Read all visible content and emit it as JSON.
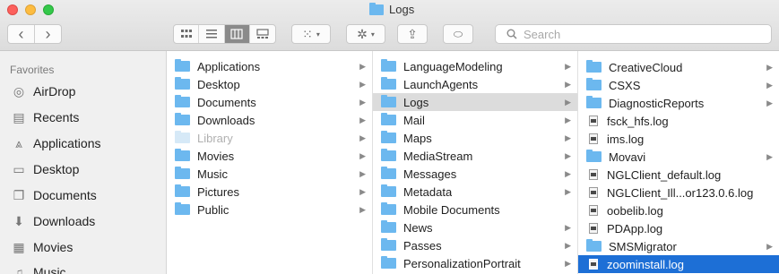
{
  "window": {
    "title": "Logs"
  },
  "toolbar": {
    "back_glyph": "‹",
    "forward_glyph": "›",
    "view_icons": [
      "grid-view-icon",
      "list-view-icon",
      "column-view-icon",
      "gallery-view-icon"
    ],
    "group_glyph": "⁙",
    "action_glyph": "✲",
    "share_glyph": "⇪",
    "tag_glyph": "⬭",
    "search_placeholder": "Search"
  },
  "sidebar": {
    "heading": "Favorites",
    "items": [
      {
        "label": "AirDrop",
        "icon": "airdrop-icon",
        "glyph": "◎"
      },
      {
        "label": "Recents",
        "icon": "recents-icon",
        "glyph": "▤"
      },
      {
        "label": "Applications",
        "icon": "applications-icon",
        "glyph": "⩓"
      },
      {
        "label": "Desktop",
        "icon": "desktop-icon",
        "glyph": "▭"
      },
      {
        "label": "Documents",
        "icon": "documents-icon",
        "glyph": "❐"
      },
      {
        "label": "Downloads",
        "icon": "downloads-icon",
        "glyph": "⬇"
      },
      {
        "label": "Movies",
        "icon": "movies-icon",
        "glyph": "▦"
      },
      {
        "label": "Music",
        "icon": "music-icon",
        "glyph": "♫"
      }
    ]
  },
  "columns": [
    {
      "items": [
        {
          "label": "Applications",
          "type": "folder",
          "chevron": true
        },
        {
          "label": "Desktop",
          "type": "folder",
          "chevron": true
        },
        {
          "label": "Documents",
          "type": "folder",
          "chevron": true
        },
        {
          "label": "Downloads",
          "type": "folder",
          "chevron": true
        },
        {
          "label": "Library",
          "type": "folder",
          "chevron": true,
          "state": "selected-dim"
        },
        {
          "label": "Movies",
          "type": "folder",
          "chevron": true
        },
        {
          "label": "Music",
          "type": "folder",
          "chevron": true
        },
        {
          "label": "Pictures",
          "type": "folder",
          "chevron": true
        },
        {
          "label": "Public",
          "type": "folder",
          "chevron": true
        }
      ]
    },
    {
      "items": [
        {
          "label": "LanguageModeling",
          "type": "folder",
          "chevron": true
        },
        {
          "label": "LaunchAgents",
          "type": "folder",
          "chevron": true
        },
        {
          "label": "Logs",
          "type": "folder",
          "chevron": true,
          "state": "selected-gray"
        },
        {
          "label": "Mail",
          "type": "folder",
          "chevron": true
        },
        {
          "label": "Maps",
          "type": "folder",
          "chevron": true
        },
        {
          "label": "MediaStream",
          "type": "folder",
          "chevron": true
        },
        {
          "label": "Messages",
          "type": "folder",
          "chevron": true
        },
        {
          "label": "Metadata",
          "type": "folder",
          "chevron": true
        },
        {
          "label": "Mobile Documents",
          "type": "folder",
          "chevron": false
        },
        {
          "label": "News",
          "type": "folder",
          "chevron": true
        },
        {
          "label": "Passes",
          "type": "folder",
          "chevron": true
        },
        {
          "label": "PersonalizationPortrait",
          "type": "folder",
          "chevron": true
        }
      ]
    },
    {
      "items": [
        {
          "label": "CreativeCloud",
          "type": "folder",
          "chevron": true
        },
        {
          "label": "CSXS",
          "type": "folder",
          "chevron": true
        },
        {
          "label": "DiagnosticReports",
          "type": "folder",
          "chevron": true
        },
        {
          "label": "fsck_hfs.log",
          "type": "file",
          "chevron": false
        },
        {
          "label": "ims.log",
          "type": "file",
          "chevron": false
        },
        {
          "label": "Movavi",
          "type": "folder",
          "chevron": true
        },
        {
          "label": "NGLClient_default.log",
          "type": "file",
          "chevron": false
        },
        {
          "label": "NGLClient_Ill...or123.0.6.log",
          "type": "file",
          "chevron": false
        },
        {
          "label": "oobelib.log",
          "type": "file",
          "chevron": false
        },
        {
          "label": "PDApp.log",
          "type": "file",
          "chevron": false
        },
        {
          "label": "SMSMigrator",
          "type": "folder",
          "chevron": true
        },
        {
          "label": "zoominstall.log",
          "type": "file",
          "chevron": false,
          "state": "selected-blue"
        }
      ]
    }
  ]
}
